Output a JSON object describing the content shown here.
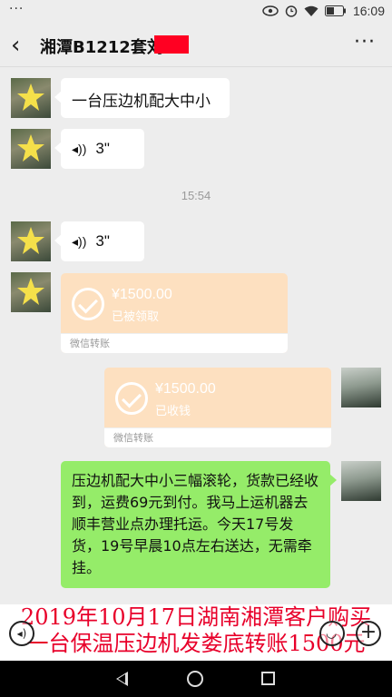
{
  "status_bar": {
    "time": "16:09",
    "icons": [
      "eye-icon",
      "alarm-icon",
      "wifi-icon",
      "battery-icon"
    ]
  },
  "header": {
    "title": "湘潭B1212套刘",
    "back_icon": "chevron-left-icon",
    "more_icon": "more-dots-icon"
  },
  "messages": [
    {
      "type": "text",
      "from": "other",
      "text": "一台压边机配大中小"
    },
    {
      "type": "voice",
      "from": "other",
      "duration": "3\""
    },
    {
      "type": "timestamp",
      "text": "15:54"
    },
    {
      "type": "voice",
      "from": "other",
      "duration": "3\""
    },
    {
      "type": "transfer",
      "from": "other",
      "amount": "¥1500.00",
      "status": "已被领取",
      "footer": "微信转账"
    },
    {
      "type": "transfer",
      "from": "me",
      "amount": "¥1500.00",
      "status": "已收钱",
      "footer": "微信转账"
    },
    {
      "type": "text",
      "from": "me",
      "text": "压边机配大中小三幅滚轮，货款已经收到，运费69元到付。我马上运机器去顺丰营业点办理托运。今天17号发货，19号早晨10点左右送达，无需牵挂。"
    }
  ],
  "caption": {
    "line1": "2019年10月17日湖南湘潭客户购买",
    "line2": "一台保温压边机发娄底转账1500元"
  },
  "colors": {
    "background": "#ededed",
    "my_bubble": "#95ec69",
    "transfer_card": "#fde0c0",
    "caption_text": "#e8002a"
  }
}
